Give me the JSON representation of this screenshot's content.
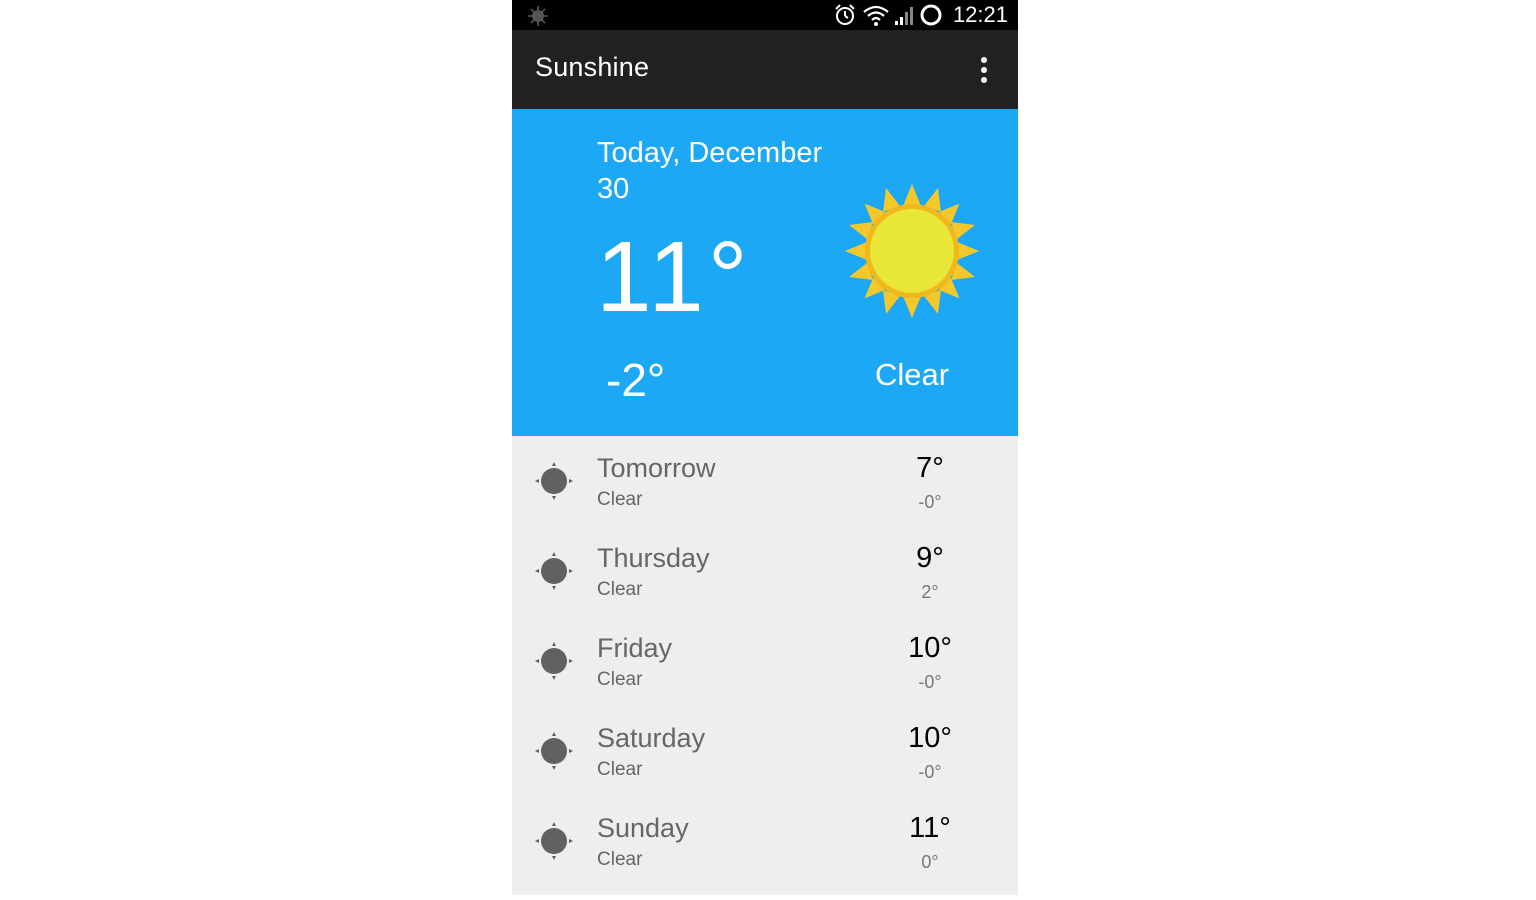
{
  "status_bar": {
    "time": "12:21",
    "icons": [
      "bug-icon",
      "alarm-icon",
      "wifi-icon",
      "signal-icon",
      "ring-icon"
    ]
  },
  "app": {
    "title": "Sunshine",
    "overflow_icon": "more-vert-icon"
  },
  "today": {
    "date": "Today, December 30",
    "high": "11°",
    "low": "-2°",
    "condition": "Clear",
    "art": "sun-art",
    "colors": {
      "panel": "#1ca8f4",
      "sun_rays": "#f4c82a",
      "sun_core": "#e9e63a"
    }
  },
  "forecast": [
    {
      "day": "Tomorrow",
      "description": "Clear",
      "high": "7°",
      "low": "-0°",
      "icon": "clear-sun-icon"
    },
    {
      "day": "Thursday",
      "description": "Clear",
      "high": "9°",
      "low": "2°",
      "icon": "clear-sun-icon"
    },
    {
      "day": "Friday",
      "description": "Clear",
      "high": "10°",
      "low": "-0°",
      "icon": "clear-sun-icon"
    },
    {
      "day": "Saturday",
      "description": "Clear",
      "high": "10°",
      "low": "-0°",
      "icon": "clear-sun-icon"
    },
    {
      "day": "Sunday",
      "description": "Clear",
      "high": "11°",
      "low": "0°",
      "icon": "clear-sun-icon"
    }
  ]
}
